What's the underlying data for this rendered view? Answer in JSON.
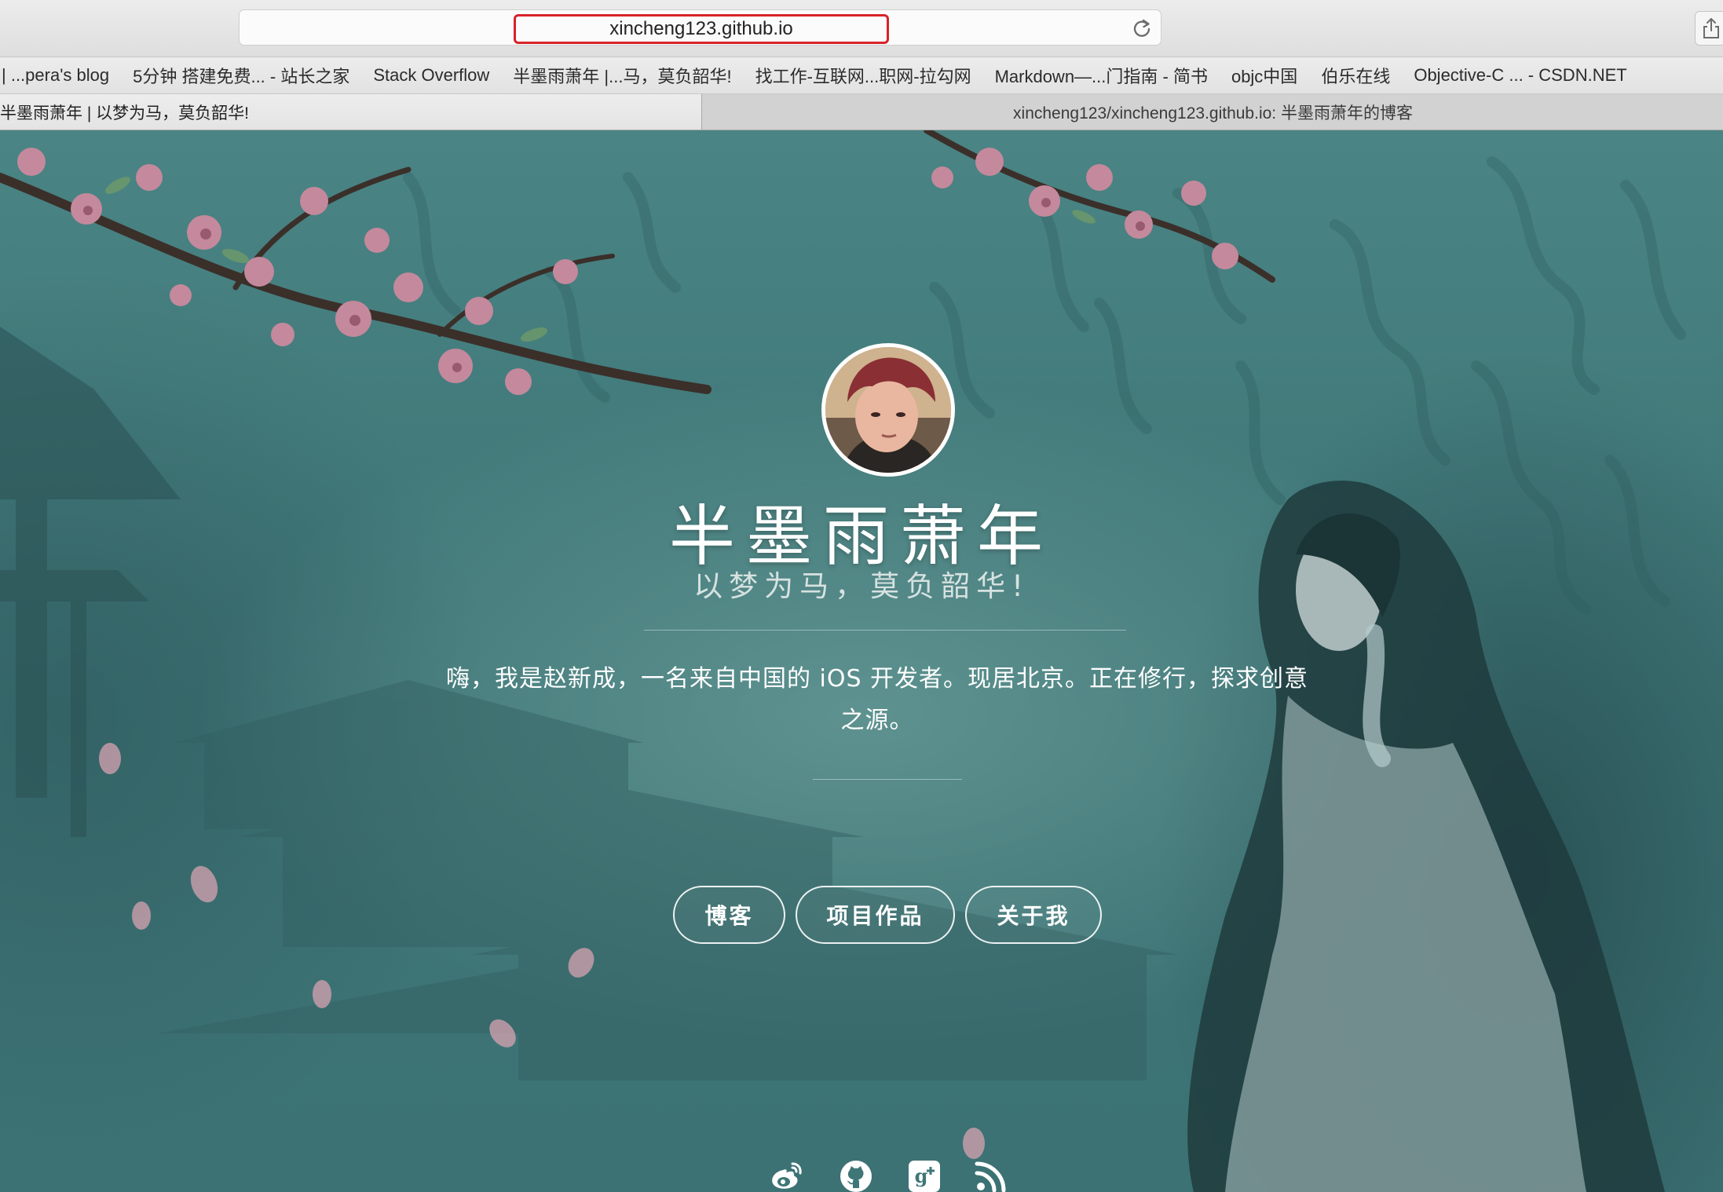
{
  "browser": {
    "url": "xincheng123.github.io",
    "bookmarks": [
      "| ...pera's blog",
      "5分钟 搭建免费... - 站长之家",
      "Stack Overflow",
      "半墨雨萧年 |...马，莫负韶华!",
      "找工作-互联网...职网-拉勾网",
      "Markdown—...门指南 - 简书",
      "objc中国",
      "伯乐在线",
      "Objective-C ... - CSDN.NET"
    ],
    "tabs": [
      {
        "label": "半墨雨萧年 | 以梦为马，莫负韶华!"
      },
      {
        "label": "xincheng123/xincheng123.github.io: 半墨雨萧年的博客"
      }
    ]
  },
  "hero": {
    "title": "半墨雨萧年",
    "subtitle": "以梦为马，莫负韶华!",
    "intro": "嗨，我是赵新成，一名来自中国的 iOS 开发者。现居北京。正在修行，探求创意之源。",
    "buttons": {
      "blog": "博客",
      "projects": "项目作品",
      "about": "关于我"
    },
    "social_icons": [
      "weibo-icon",
      "github-icon",
      "google-plus-icon",
      "rss-icon"
    ]
  },
  "colors": {
    "url_highlight": "#d7232a",
    "background_teal": "#3f7677",
    "text": "#ffffff"
  }
}
